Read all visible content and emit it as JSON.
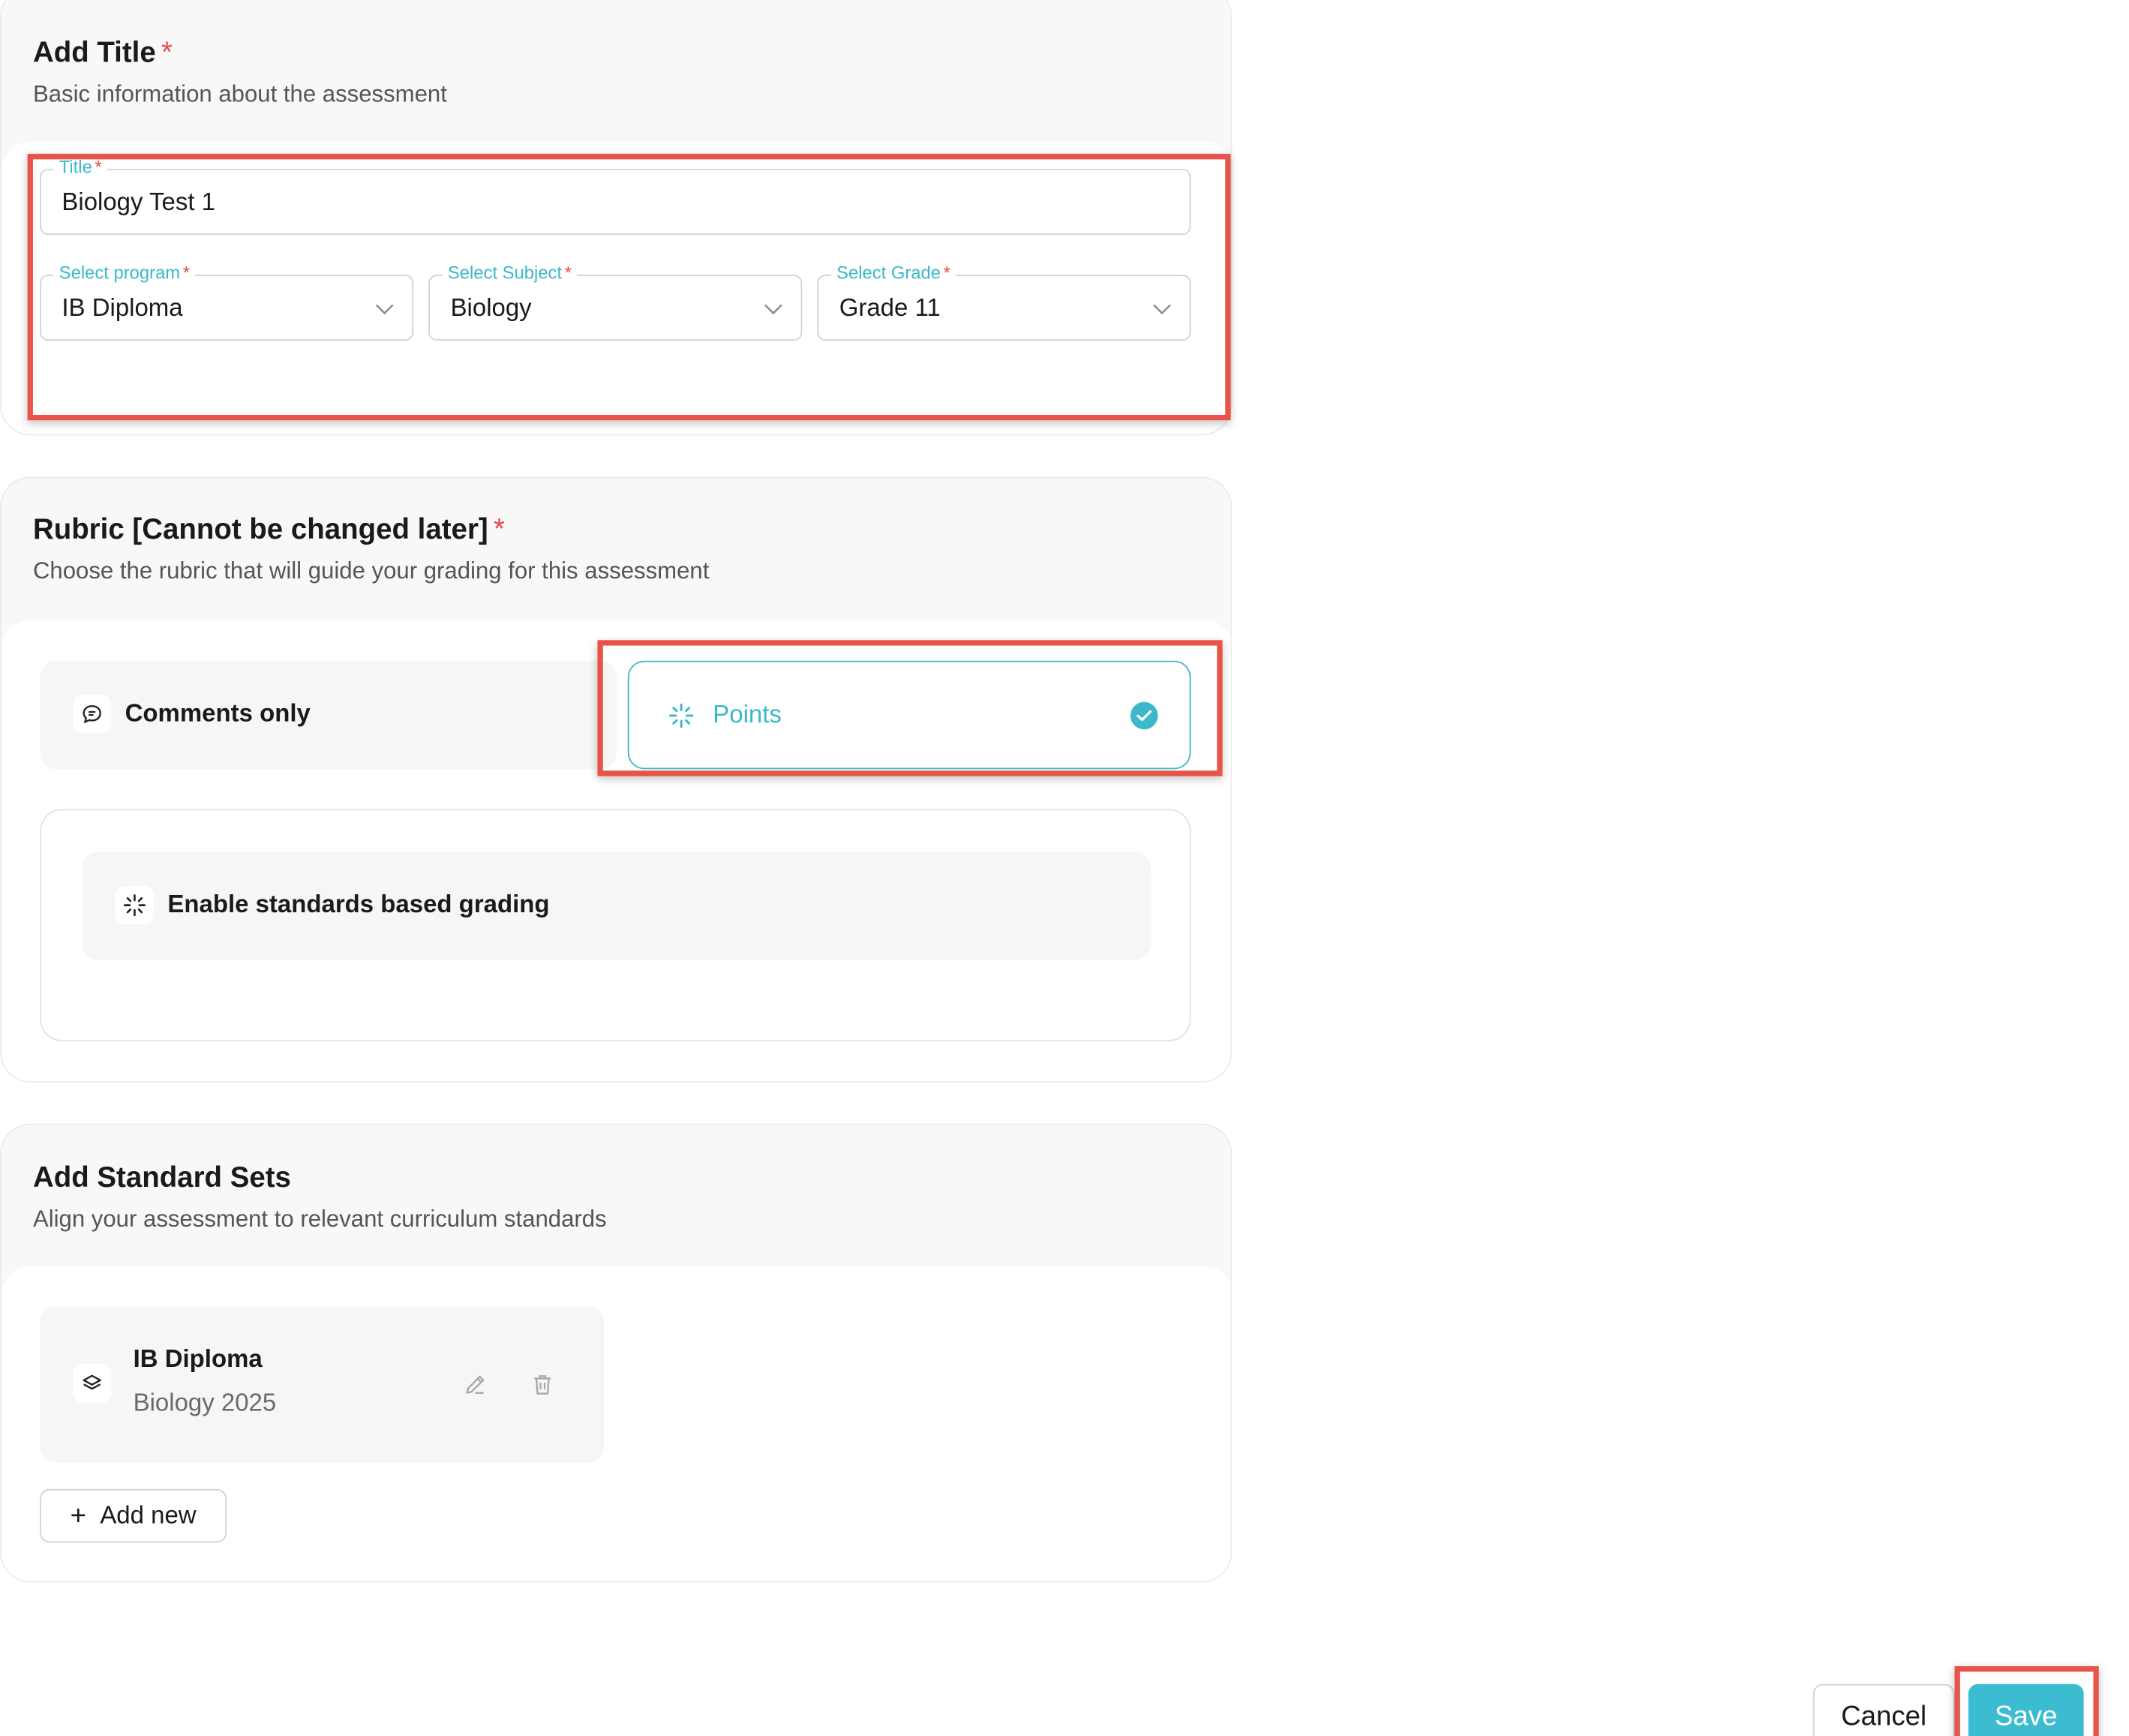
{
  "title_section": {
    "heading": "Add Title",
    "required_mark": "*",
    "subtitle": "Basic information about the assessment",
    "title_field": {
      "label": "Title",
      "value": "Biology Test 1"
    },
    "program_field": {
      "label": "Select program",
      "value": "IB Diploma"
    },
    "subject_field": {
      "label": "Select Subject",
      "value": "Biology"
    },
    "grade_field": {
      "label": "Select Grade",
      "value": "Grade 11"
    }
  },
  "rubric_section": {
    "heading": "Rubric [Cannot be changed later]",
    "required_mark": "*",
    "subtitle": "Choose the rubric that will guide your grading for this assessment",
    "options": [
      {
        "label": "Comments only",
        "icon": "chat-bubble-icon",
        "selected": false
      },
      {
        "label": "Points",
        "icon": "sparkle-icon",
        "selected": true
      }
    ],
    "standards_toggle": {
      "label": "Enable standards based grading",
      "icon": "sparkle-icon"
    }
  },
  "standards_section": {
    "heading": "Add Standard Sets",
    "subtitle": "Align your assessment to relevant curriculum standards",
    "sets": [
      {
        "name": "IB Diploma",
        "detail": "Biology 2025",
        "icon": "layers-icon"
      }
    ],
    "add_label": "Add new"
  },
  "footer": {
    "cancel_label": "Cancel",
    "save_label": "Save"
  },
  "colors": {
    "accent": "#3bb8c9",
    "required": "#e5484d",
    "highlight": "#e8534a"
  }
}
